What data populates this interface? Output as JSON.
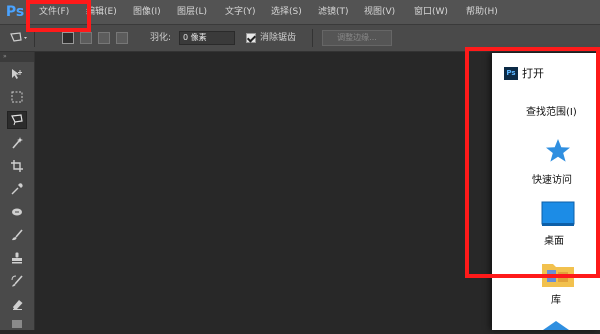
{
  "app": {
    "logo_text": "Ps"
  },
  "menu": {
    "items": [
      "文件(F)",
      "编辑(E)",
      "图像(I)",
      "图层(L)",
      "文字(Y)",
      "选择(S)",
      "滤镜(T)",
      "视图(V)",
      "窗口(W)",
      "帮助(H)"
    ]
  },
  "options_bar": {
    "feather_label": "羽化:",
    "feather_value": "0 像素",
    "antialias_label": "消除锯齿",
    "antialias_checked": true,
    "refine_edge_label": "调整边缘..."
  },
  "toolbar": {
    "tools": [
      "move-tool",
      "marquee-tool",
      "lasso-tool",
      "magic-wand-tool",
      "crop-tool",
      "eyedropper-tool",
      "spot-healing-tool",
      "brush-tool",
      "clone-stamp-tool",
      "history-brush-tool",
      "eraser-tool"
    ],
    "active_tool": "lasso-tool"
  },
  "dialog": {
    "icon_text": "Ps",
    "title": "打开",
    "look_in_label": "查找范围(I)",
    "places": [
      {
        "label": "快速访问",
        "icon": "star-icon"
      },
      {
        "label": "桌面",
        "icon": "desktop-icon"
      },
      {
        "label": "库",
        "icon": "library-folder-icon"
      }
    ]
  },
  "colors": {
    "highlight": "#ff1a1a",
    "quick_access_star": "#2f8fe0",
    "desktop_blue": "#1c8ce6",
    "library_folder": "#f2c14e"
  }
}
